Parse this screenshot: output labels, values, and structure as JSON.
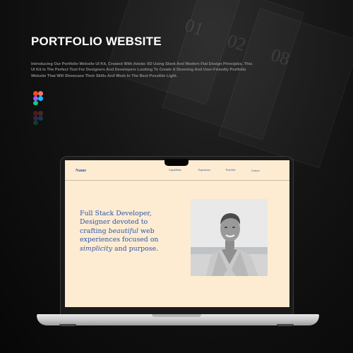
{
  "header": {
    "title": "PORTFOLIO WEBSITE",
    "description": "Introducing Our Portfolio Website UI Kit, Created With Adobe XD Using Sleek And Modern Flat Design Principles. This UI Kit Is The Perfect Tool For Designers And Developers Looking To Create A Stunning And User-Friendly Portfolio Website That Will Showcase Their Skills And Work In The Best Possible Light.",
    "tools": [
      "figma-icon",
      "xd-icon"
    ]
  },
  "background": {
    "sheet_numbers": [
      "01",
      "02",
      "08"
    ]
  },
  "website": {
    "brand": "Name",
    "nav": [
      "Capabilities",
      "Experience",
      "Portfolio",
      "Contact"
    ],
    "hero": {
      "line1": "Full Stack Developer,",
      "line2": "Designer devoted to",
      "line3_prefix": "crafting ",
      "line3_emphasis": "beautiful",
      "line3_suffix": " web",
      "line4": "experiences focused on",
      "line5_emphasis": "simplicity",
      "line5_suffix": " and purpose."
    },
    "portrait": "portrait-photo"
  },
  "colors": {
    "page_background": "#0e0e0e",
    "screen_background": "#fdecd2",
    "accent_text": "#2e56a8",
    "title": "#ffffff",
    "description": "#8a8a8a"
  }
}
